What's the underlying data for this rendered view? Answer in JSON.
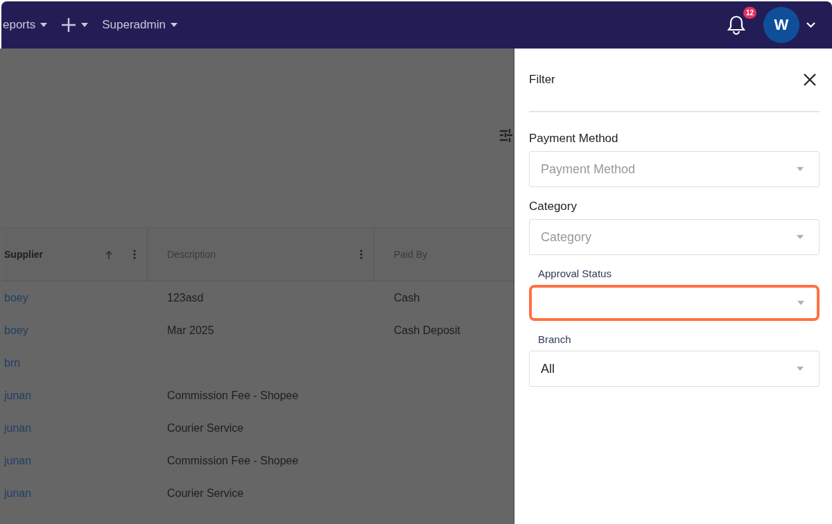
{
  "navbar": {
    "menus": [
      {
        "kind": "text",
        "label": "eports"
      },
      {
        "kind": "plus"
      },
      {
        "kind": "text",
        "label": "Superadmin"
      }
    ],
    "notifications": {
      "count": "12"
    },
    "avatar": {
      "initial": "W"
    }
  },
  "table": {
    "columns": [
      {
        "label": "Supplier",
        "sorted": true,
        "menu": true
      },
      {
        "label": "Description",
        "sorted": false,
        "menu": true
      },
      {
        "label": "Paid By",
        "sorted": false,
        "menu": false
      }
    ],
    "rows": [
      [
        "boey",
        "123asd",
        "Cash"
      ],
      [
        "boey",
        "Mar 2025",
        "Cash Deposit"
      ],
      [
        "brn",
        "",
        ""
      ],
      [
        "junan",
        "Commission Fee - Shopee",
        ""
      ],
      [
        "junan",
        "Courier Service",
        ""
      ],
      [
        "junan",
        "Commission Fee - Shopee",
        ""
      ],
      [
        "junan",
        "Courier Service",
        ""
      ]
    ]
  },
  "filter": {
    "title": "Filter",
    "fields": [
      {
        "kind": "plain",
        "label": "Payment Method",
        "placeholder": "Payment Method",
        "highlighted": false
      },
      {
        "kind": "plain",
        "label": "Category",
        "placeholder": "Category",
        "highlighted": false
      },
      {
        "kind": "outlined",
        "label": "Approval Status",
        "highlighted": true
      },
      {
        "kind": "outlined",
        "label": "Branch",
        "value": "All",
        "highlighted": false
      }
    ]
  }
}
